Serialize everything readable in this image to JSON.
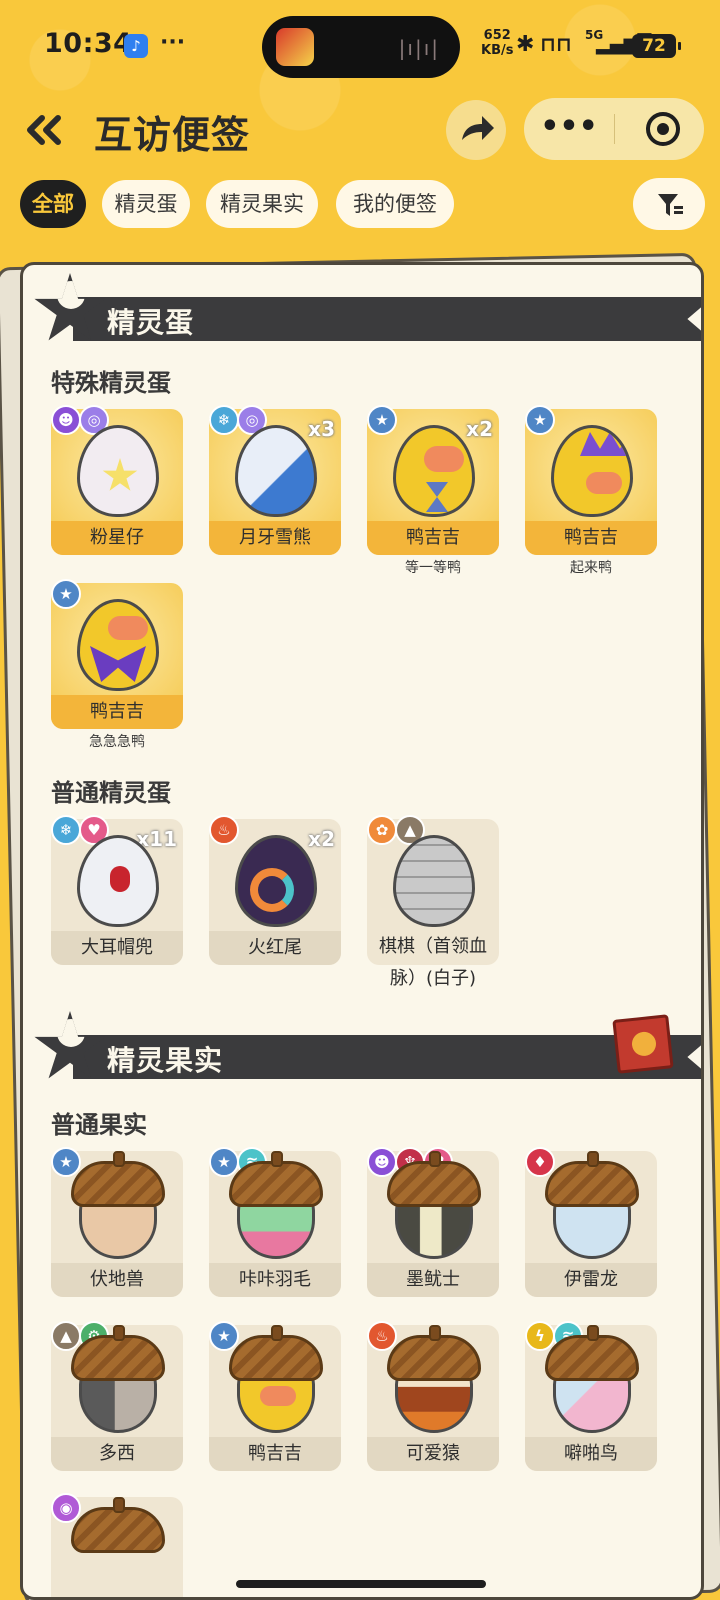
{
  "status_bar": {
    "time": "10:34",
    "net_speed_value": "652",
    "net_speed_unit": "KB/s",
    "network_type": "5G",
    "battery": "72"
  },
  "header": {
    "title": "互访便签"
  },
  "tabs": [
    {
      "label": "全部",
      "active": true
    },
    {
      "label": "精灵蛋",
      "active": false
    },
    {
      "label": "精灵果实",
      "active": false
    },
    {
      "label": "我的便签",
      "active": false
    }
  ],
  "sections": {
    "eggs": {
      "title": "精灵蛋",
      "special_title": "特殊精灵蛋",
      "special": [
        {
          "name": "粉星仔",
          "qty": "",
          "sub": ""
        },
        {
          "name": "月牙雪熊",
          "qty": "x3",
          "sub": ""
        },
        {
          "name": "鸭吉吉",
          "qty": "x2",
          "sub": "等一等鸭"
        },
        {
          "name": "鸭吉吉",
          "qty": "",
          "sub": "起来鸭"
        },
        {
          "name": "鸭吉吉",
          "qty": "",
          "sub": "急急急鸭"
        }
      ],
      "normal_title": "普通精灵蛋",
      "normal": [
        {
          "name": "大耳帽兜",
          "qty": "x11"
        },
        {
          "name": "火红尾",
          "qty": "x2"
        },
        {
          "name_line1": "棋棋（首领血",
          "name_line2": "脉）(白子)",
          "qty": ""
        }
      ]
    },
    "fruits": {
      "title": "精灵果实",
      "normal_title": "普通果实",
      "items": [
        {
          "name": "伏地兽"
        },
        {
          "name": "咔咔羽毛"
        },
        {
          "name": "墨鱿士"
        },
        {
          "name": "伊雷龙"
        },
        {
          "name": "多西"
        },
        {
          "name": "鸭吉吉"
        },
        {
          "name": "可爱猿"
        },
        {
          "name": "噼啪鸟"
        }
      ]
    }
  },
  "colors": {
    "background": "#f9c83b",
    "active_tab_bg": "#1f1f1f",
    "active_tab_text": "#f9c83b",
    "special_tile": "#f3b53a",
    "normal_tile": "#e2d8c2"
  }
}
